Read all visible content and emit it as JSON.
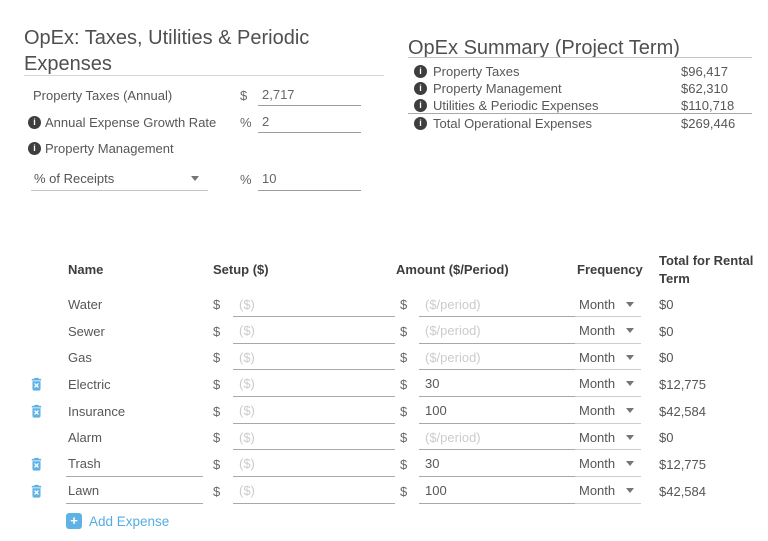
{
  "left_panel": {
    "title": "OpEx: Taxes, Utilities & Periodic Expenses",
    "property_taxes": {
      "label": "Property Taxes (Annual)",
      "symbol": "$",
      "value": "2,717"
    },
    "growth_rate": {
      "label": "Annual Expense Growth Rate",
      "symbol": "%",
      "value": "2"
    },
    "property_management": {
      "label": "Property Management"
    },
    "management_method": {
      "selected_option": "% of Receipts",
      "symbol": "%",
      "value": "10"
    }
  },
  "summary_panel": {
    "title": "OpEx Summary (Project Term)",
    "rows": [
      {
        "label": "Property Taxes",
        "value": "$96,417"
      },
      {
        "label": "Property Management",
        "value": "$62,310"
      },
      {
        "label": "Utilities & Periodic Expenses",
        "value": "$110,718"
      }
    ],
    "total_row": {
      "label": "Total Operational Expenses",
      "value": "$269,446"
    }
  },
  "expense_table": {
    "headers": {
      "name": "Name",
      "setup": "Setup ($)",
      "amount": "Amount ($/Period)",
      "frequency": "Frequency",
      "total": "Total for Rental Term"
    },
    "currency_symbol": "$",
    "setup_placeholder": "($)",
    "amount_placeholder": "($/period)",
    "rows": [
      {
        "name": "Water",
        "deletable": false,
        "name_editable": false,
        "setup_value": "",
        "amount_value": "",
        "frequency": "Month",
        "total": "$0"
      },
      {
        "name": "Sewer",
        "deletable": false,
        "name_editable": false,
        "setup_value": "",
        "amount_value": "",
        "frequency": "Month",
        "total": "$0"
      },
      {
        "name": "Gas",
        "deletable": false,
        "name_editable": false,
        "setup_value": "",
        "amount_value": "",
        "frequency": "Month",
        "total": "$0"
      },
      {
        "name": "Electric",
        "deletable": true,
        "name_editable": false,
        "setup_value": "",
        "amount_value": "30",
        "frequency": "Month",
        "total": "$12,775"
      },
      {
        "name": "Insurance",
        "deletable": true,
        "name_editable": false,
        "setup_value": "",
        "amount_value": "100",
        "frequency": "Month",
        "total": "$42,584"
      },
      {
        "name": "Alarm",
        "deletable": false,
        "name_editable": false,
        "setup_value": "",
        "amount_value": "",
        "frequency": "Month",
        "total": "$0"
      },
      {
        "name": "Trash",
        "deletable": true,
        "name_editable": true,
        "setup_value": "",
        "amount_value": "30",
        "frequency": "Month",
        "total": "$12,775"
      },
      {
        "name": "Lawn",
        "deletable": true,
        "name_editable": true,
        "setup_value": "",
        "amount_value": "100",
        "frequency": "Month",
        "total": "$42,584"
      }
    ],
    "add_button_label": "Add Expense"
  },
  "colors": {
    "accent_blue": "#5fb2e4",
    "info_icon_bg": "#3e3e3e",
    "title_text": "#4f4f4f",
    "body_text": "#575757",
    "placeholder_text": "#cbcbcb"
  }
}
